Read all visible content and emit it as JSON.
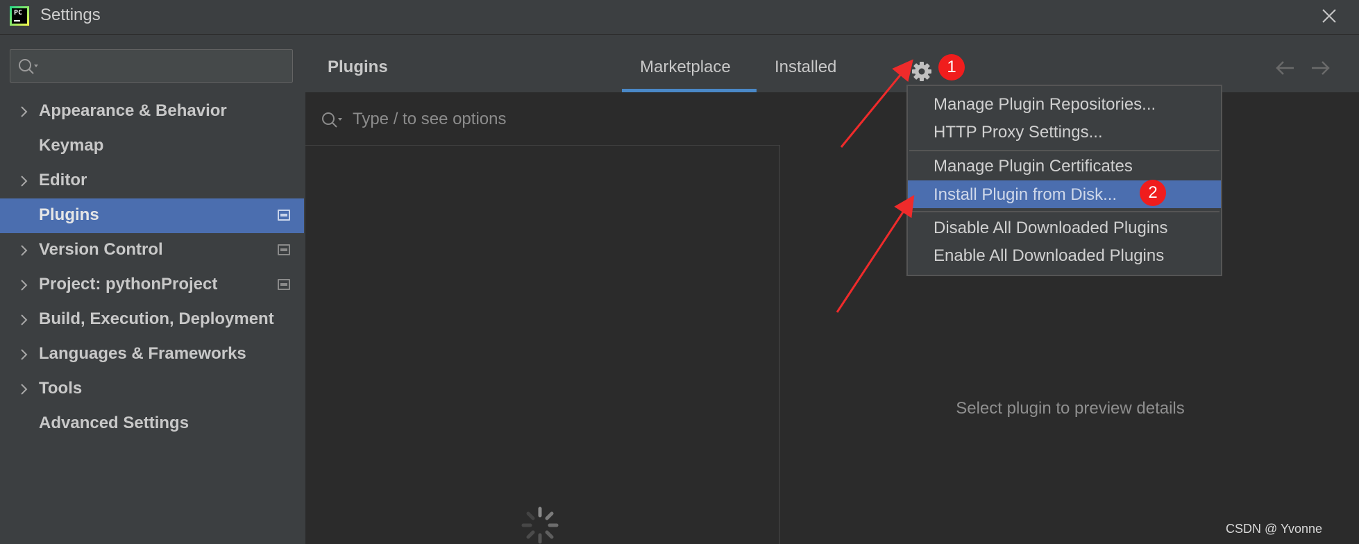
{
  "window": {
    "title": "Settings",
    "app_icon_text": "PC"
  },
  "sidebar": {
    "search": {
      "value": "",
      "placeholder": ""
    },
    "items": [
      {
        "label": "Appearance & Behavior",
        "expandable": true,
        "selected": false,
        "has_project_icon": false
      },
      {
        "label": "Keymap",
        "expandable": false,
        "selected": false,
        "has_project_icon": false
      },
      {
        "label": "Editor",
        "expandable": true,
        "selected": false,
        "has_project_icon": false
      },
      {
        "label": "Plugins",
        "expandable": false,
        "selected": true,
        "has_project_icon": true
      },
      {
        "label": "Version Control",
        "expandable": true,
        "selected": false,
        "has_project_icon": true
      },
      {
        "label": "Project: pythonProject",
        "expandable": true,
        "selected": false,
        "has_project_icon": true
      },
      {
        "label": "Build, Execution, Deployment",
        "expandable": true,
        "selected": false,
        "has_project_icon": false
      },
      {
        "label": "Languages & Frameworks",
        "expandable": true,
        "selected": false,
        "has_project_icon": false
      },
      {
        "label": "Tools",
        "expandable": true,
        "selected": false,
        "has_project_icon": false
      },
      {
        "label": "Advanced Settings",
        "expandable": false,
        "selected": false,
        "has_project_icon": false
      }
    ]
  },
  "main": {
    "title": "Plugins",
    "tabs": [
      {
        "label": "Marketplace",
        "active": true
      },
      {
        "label": "Installed",
        "active": false
      }
    ],
    "search": {
      "value": "",
      "placeholder": "Type / to see options"
    },
    "detail_hint": "Select plugin to preview details"
  },
  "gear_menu": {
    "items": [
      {
        "label": "Manage Plugin Repositories...",
        "highlighted": false
      },
      {
        "label": "HTTP Proxy Settings...",
        "highlighted": false
      },
      {
        "label": "Manage Plugin Certificates",
        "highlighted": false
      },
      {
        "label": "Install Plugin from Disk...",
        "highlighted": true
      },
      {
        "label": "Disable All Downloaded Plugins",
        "highlighted": false
      },
      {
        "label": "Enable All Downloaded Plugins",
        "highlighted": false
      }
    ]
  },
  "annotations": {
    "badge_1": "1",
    "badge_2": "2"
  },
  "watermark": "CSDN @ Yvonne ",
  "colors": {
    "selection": "#4b6eaf",
    "tab_underline": "#4a88c7",
    "annotation_red": "#f01d1d",
    "panel_bg": "#3c3f41",
    "content_bg": "#2b2b2b"
  },
  "icons": {
    "close": "close-icon",
    "gear": "gear-icon",
    "back": "arrow-left-icon",
    "forward": "arrow-right-icon",
    "search": "search-icon",
    "expand": "chevron-right-icon",
    "project_scope": "project-scope-icon",
    "loading": "spinner-icon"
  }
}
